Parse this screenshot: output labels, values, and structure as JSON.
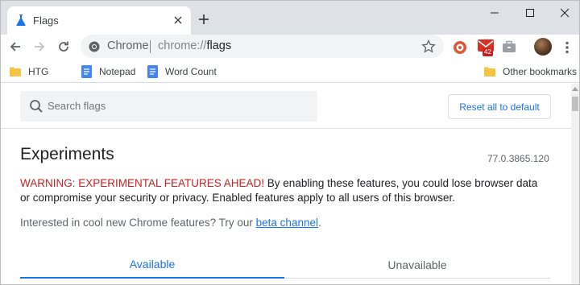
{
  "tab": {
    "title": "Flags"
  },
  "omnibox": {
    "chip": "Chrome",
    "url_scheme": "chrome://",
    "url_host": "flags"
  },
  "extensions": {
    "mail_badge": "42"
  },
  "bookmarks": {
    "items": [
      {
        "label": "HTG",
        "icon": "folder-icon"
      },
      {
        "label": "Notepad",
        "icon": "docs-icon"
      },
      {
        "label": "Word Count",
        "icon": "docs-icon"
      }
    ],
    "other_label": "Other bookmarks"
  },
  "page": {
    "search_placeholder": "Search flags",
    "reset_label": "Reset all to default",
    "title": "Experiments",
    "version": "77.0.3865.120",
    "warning_red": "WARNING: EXPERIMENTAL FEATURES AHEAD!",
    "warning_rest": " By enabling these features, you could lose browser data or compromise your security or privacy. Enabled features apply to all users of this browser.",
    "interested_text": "Interested in cool new Chrome features? Try our ",
    "beta_link": "beta channel",
    "interested_end": ".",
    "tabs": {
      "available": "Available",
      "unavailable": "Unavailable"
    }
  },
  "colors": {
    "accent": "#1a73e8",
    "warning": "#c5221f",
    "tabstrip": "#dee1e6"
  }
}
